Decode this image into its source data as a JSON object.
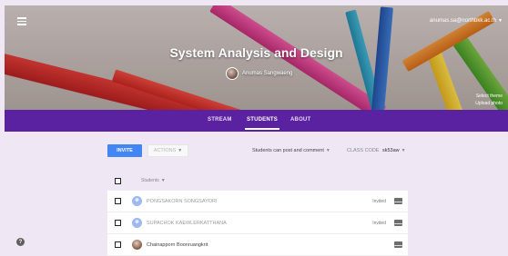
{
  "header": {
    "course_title": "System Analysis and Design",
    "teacher_name": "Anumas Sangwaeng",
    "account_email": "anumas.sa@northbkk.ac.th",
    "theme_links": [
      "Select theme",
      "Upload photo"
    ]
  },
  "tabs": [
    {
      "label": "STREAM",
      "active": false
    },
    {
      "label": "STUDENTS",
      "active": true
    },
    {
      "label": "ABOUT",
      "active": false
    }
  ],
  "controls": {
    "invite_label": "INVITE",
    "actions_label": "ACTIONS",
    "post_permission": "Students can post and comment",
    "class_code_label": "CLASS CODE",
    "class_code_value": "sk53aw"
  },
  "list": {
    "sort_label": "Students",
    "rows": [
      {
        "name": "PONGSAKORN SONGSAYORI",
        "status": "Invited"
      },
      {
        "name": "SUPACHOK KAEWLERKATTHANA",
        "status": "Invited"
      },
      {
        "name": "Chainapporn Boonruangkrit",
        "status": ""
      }
    ]
  },
  "colors": {
    "tabbar": "#5a22a0",
    "invite": "#4285f4",
    "page_bg": "#efe7f3"
  },
  "icons": {
    "menu": "hamburger-menu-icon",
    "mail": "envelope-icon",
    "help": "help-circle-icon"
  }
}
